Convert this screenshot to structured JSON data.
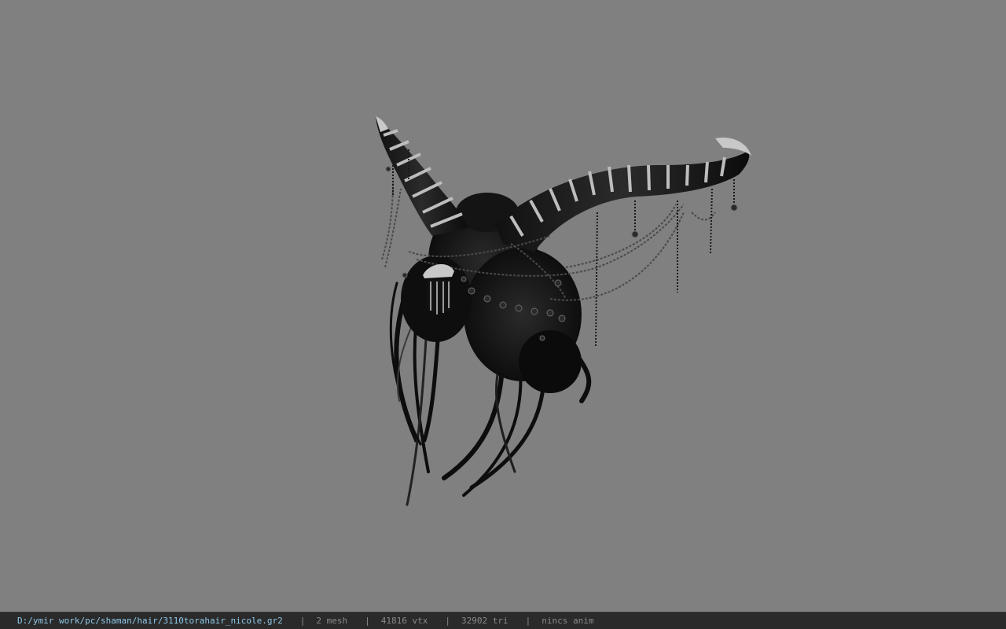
{
  "viewer": {
    "background_color": "#808080",
    "model_icon": "horned-hair-model"
  },
  "status_bar": {
    "file_path": "D:/ymir work/pc/shaman/hair/3110torahair_nicole.gr2",
    "separator": "|",
    "mesh_count": "2 mesh",
    "vertex_count": "41816 vtx",
    "triangle_count": "32902 tri",
    "anim_status": "nincs anim",
    "path_color": "#8ec8e8",
    "text_color": "#8a8a8a"
  }
}
